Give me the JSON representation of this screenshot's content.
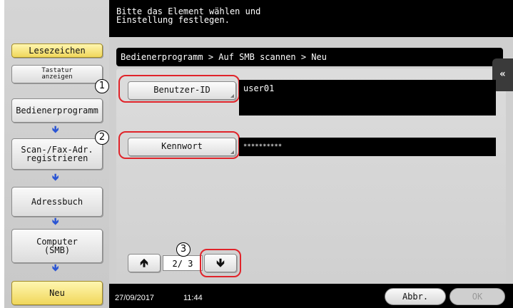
{
  "header": {
    "instruction": "Bitte das Element wählen und\nEinstellung festlegen."
  },
  "sidebar": {
    "bookmark_label": "Lesezeichen",
    "keyboard_label": "Tastatur\nanzeigen",
    "items": [
      {
        "label": "Bedienerprogramm"
      },
      {
        "label": "Scan-/Fax-Adr.\nregistrieren"
      },
      {
        "label": "Adressbuch"
      },
      {
        "label": "Computer\n(SMB)"
      },
      {
        "label": "Neu"
      }
    ]
  },
  "main": {
    "breadcrumb": "Bedienerprogramm > Auf SMB scannen > Neu",
    "user_id_label": "Benutzer-ID",
    "user_id_value": "user01",
    "password_label": "Kennwort",
    "password_value": "**********",
    "page_indicator": "2/ 3",
    "annotations": [
      "1",
      "2",
      "3"
    ]
  },
  "footer": {
    "date": "27/09/2017",
    "time": "11:44",
    "cancel_label": "Abbr.",
    "ok_label": "OK"
  },
  "icons": {
    "collapse": "double-chevron-left-icon",
    "page_up": "arrow-up-icon",
    "page_down": "arrow-down-icon",
    "flow": "arrow-down-icon"
  },
  "colors": {
    "highlight": "#e0242a",
    "flow_arrow": "#2a55d4",
    "active_yellow": "#f0d75b"
  }
}
